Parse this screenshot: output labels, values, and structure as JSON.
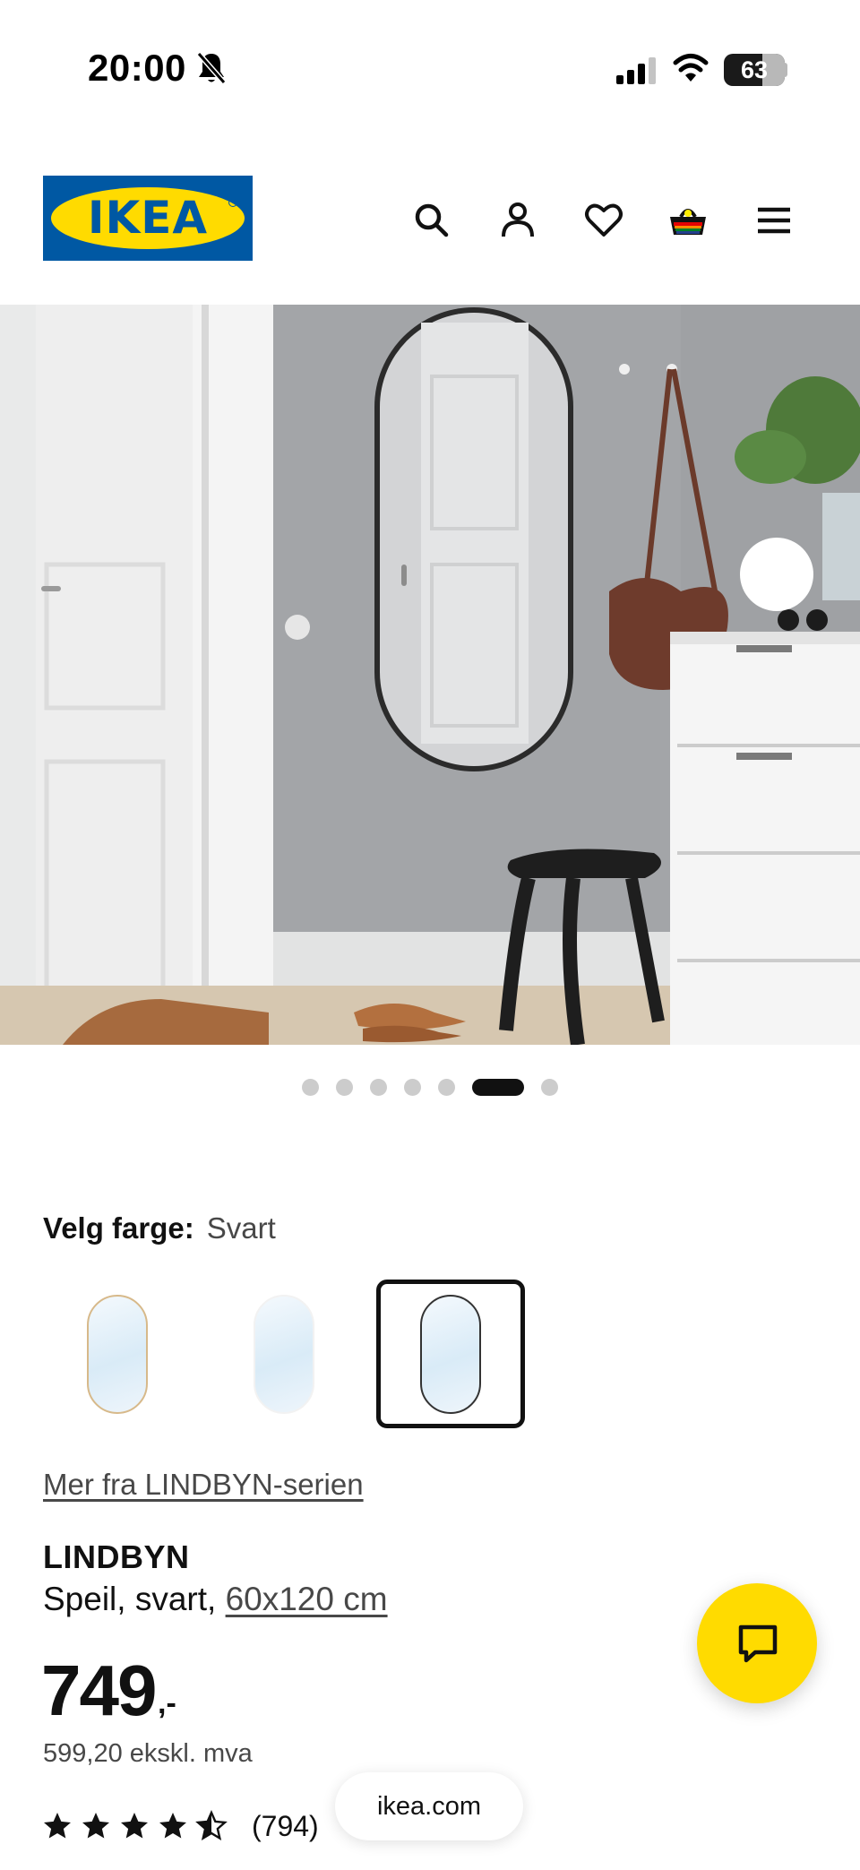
{
  "status_bar": {
    "time": "20:00",
    "battery_level": "63",
    "icons": [
      "bell-muted-icon",
      "signal-icon",
      "wifi-icon",
      "battery-icon"
    ]
  },
  "header": {
    "logo_text": "IKEA",
    "icons": [
      "search-icon",
      "account-icon",
      "heart-icon",
      "basket-icon",
      "menu-icon"
    ]
  },
  "carousel": {
    "total": 7,
    "active_index": 5
  },
  "color_selector": {
    "label": "Velg farge:",
    "value": "Svart",
    "swatches": [
      {
        "frame": "#d7b98a",
        "selected": false
      },
      {
        "frame": "#f2f2f2",
        "selected": false
      },
      {
        "frame": "#333333",
        "selected": true
      }
    ]
  },
  "series_link": "Mer fra LINDBYN-serien",
  "product": {
    "name": "LINDBYN",
    "description": "Speil, svart, ",
    "size": "60x120 cm",
    "price": "749",
    "price_suffix": ",-",
    "price_ex_vat": "599,20 ekskl. mva",
    "rating": 4.5,
    "review_count": "(794)"
  },
  "browser": {
    "url": "ikea.com"
  },
  "colors": {
    "brand_blue": "#0058a3",
    "brand_yellow": "#ffdb00",
    "text": "#111111",
    "muted": "#484848"
  }
}
